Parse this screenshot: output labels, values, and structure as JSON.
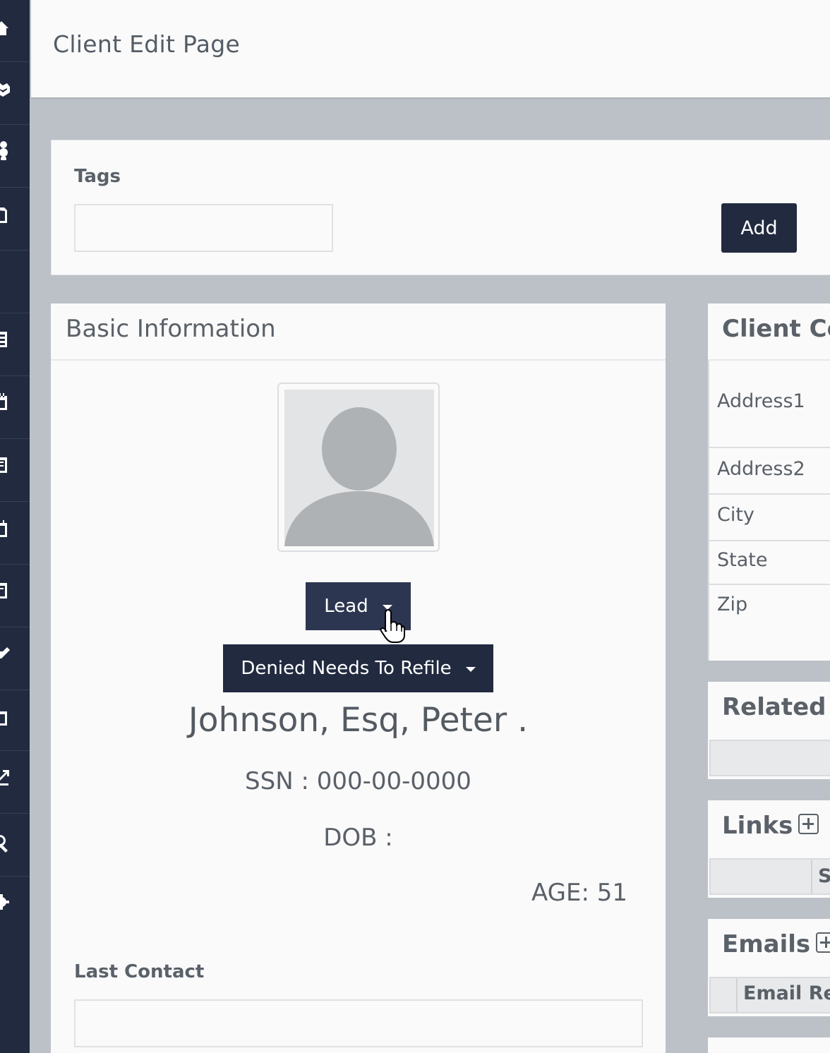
{
  "header": {
    "title": "Client Edit Page"
  },
  "sidebar": {
    "items": [
      {
        "icon": "home-icon"
      },
      {
        "icon": "handshake-icon"
      },
      {
        "icon": "users-icon"
      },
      {
        "icon": "document-icon"
      },
      {
        "icon": "blank-icon"
      },
      {
        "icon": "list-icon"
      },
      {
        "icon": "calendar-icon"
      },
      {
        "icon": "report-icon"
      },
      {
        "icon": "file-icon"
      },
      {
        "icon": "notepad-icon"
      },
      {
        "icon": "edit-icon"
      },
      {
        "icon": "clipboard-icon"
      },
      {
        "icon": "export-icon"
      },
      {
        "icon": "search-icon"
      },
      {
        "icon": "settings-icon"
      }
    ]
  },
  "tags": {
    "label": "Tags",
    "value": "",
    "add_label": "Add"
  },
  "basic": {
    "title": "Basic Information",
    "lead_label": "Lead",
    "status_label": "Denied Needs To Refile",
    "name": "Johnson, Esq, Peter .",
    "ssn": "SSN : 000-00-0000",
    "dob": "DOB :",
    "age": "AGE: 51",
    "last_contact_label": "Last Contact",
    "last_contact_value": ""
  },
  "contact": {
    "title": "Client Co",
    "fields": [
      "Address1",
      "Address2",
      "City",
      "State",
      "Zip"
    ]
  },
  "related": {
    "title": "Related C"
  },
  "links": {
    "title": "Links",
    "column": "S"
  },
  "emails": {
    "title": "Emails",
    "column": "Email Rel"
  },
  "colors": {
    "sidebar": "#212a3f",
    "button": "#212a3f",
    "background": "#bcc1c8",
    "card": "#fafafa"
  }
}
